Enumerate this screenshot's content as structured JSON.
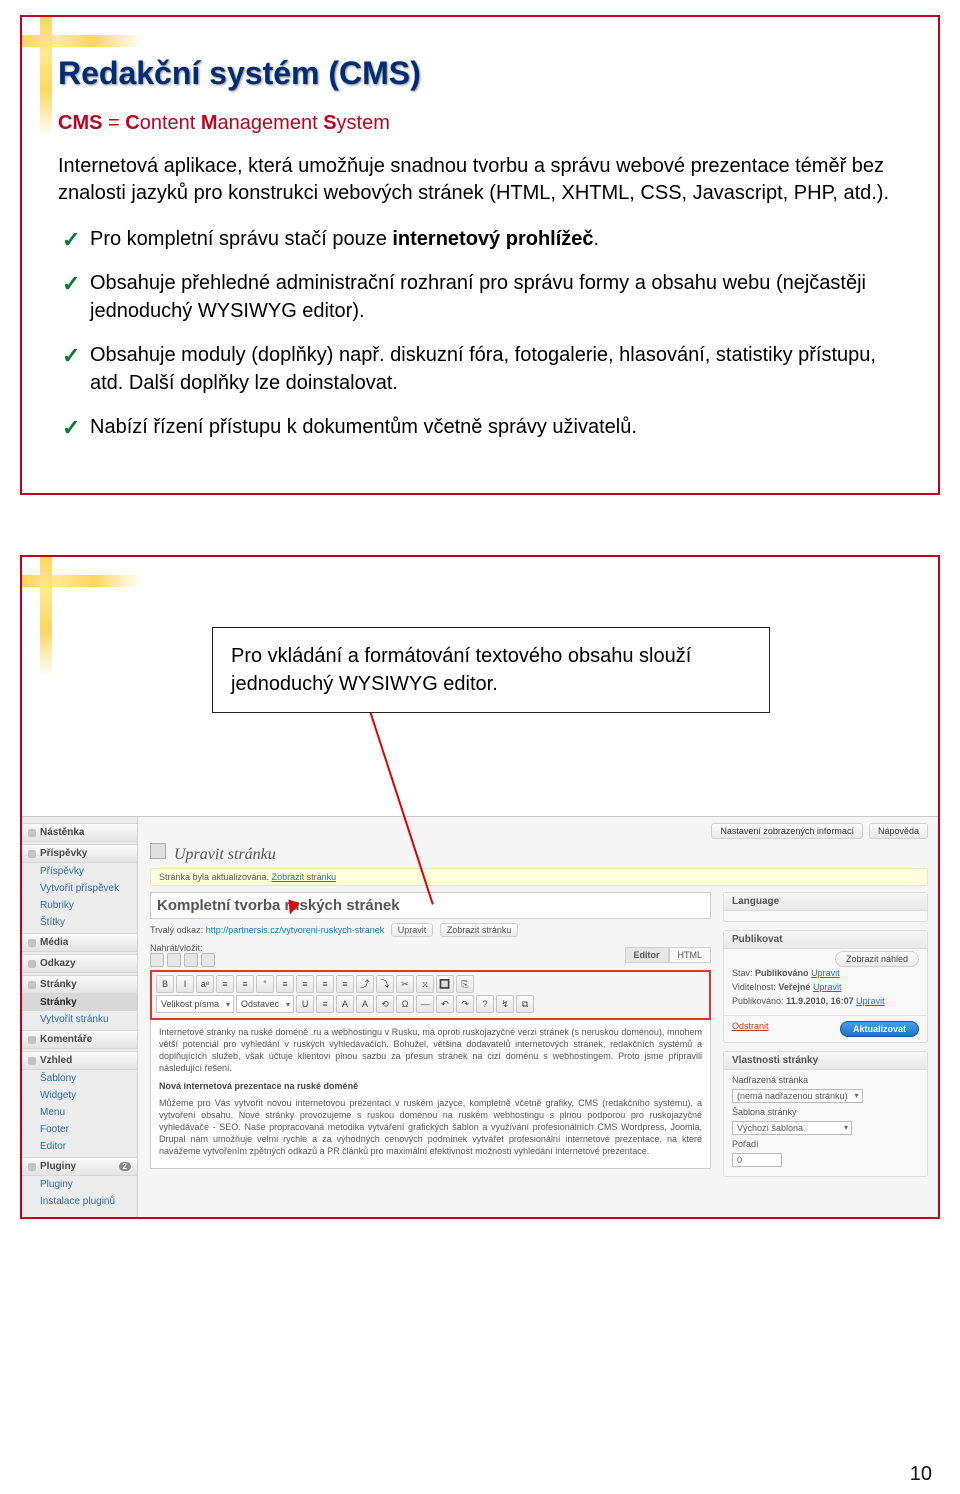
{
  "pageNumber": "10",
  "slide1": {
    "title": "Redakční systém (CMS)",
    "cms_prefix": "CMS",
    "cms_eq": " = ",
    "cms_c": "C",
    "cms_c_rest": "ontent ",
    "cms_m": "M",
    "cms_m_rest": "anagement ",
    "cms_s": "S",
    "cms_s_rest": "ystem",
    "intro": "Internetová aplikace, která umožňuje snadnou tvorbu a správu webové prezentace téměř bez znalosti jazyků pro konstrukci webových stránek (HTML, XHTML, CSS, Javascript, PHP, atd.).",
    "b1_a": "Pro kompletní správu stačí pouze ",
    "b1_b": "internetový prohlížeč",
    "b1_c": ".",
    "b2": "Obsahuje přehledné administrační rozhraní pro správu formy a obsahu webu (nejčastěji jednoduchý WYSIWYG editor).",
    "b3": "Obsahuje moduly (doplňky) např. diskuzní fóra, fotogalerie, hlasování, statistiky přístupu, atd. Další doplňky lze doinstalovat.",
    "b4": "Nabízí řízení přístupu k dokumentům včetně správy uživatelů."
  },
  "slide2": {
    "callout": "Pro vkládání a formátování textového obsahu slouží jednoduchý WYSIWYG editor.",
    "sidebar": {
      "nastenka": "Nástěnka",
      "prispevky_h": "Příspěvky",
      "prispevky": "Příspěvky",
      "vytvorit_pr": "Vytvořit příspěvek",
      "rubriky": "Rubriky",
      "stitky": "Štítky",
      "media_h": "Média",
      "odkazy_h": "Odkazy",
      "stranky_h": "Stránky",
      "stranky": "Stránky",
      "vytvorit_st": "Vytvořit stránku",
      "koment_h": "Komentáře",
      "vzhled_h": "Vzhled",
      "sablony": "Šablony",
      "widgety": "Widgety",
      "menu": "Menu",
      "footer": "Footer",
      "editor": "Editor",
      "pluginy_h": "Pluginy",
      "pluginy_badge": "2",
      "pluginy": "Pluginy",
      "instalace": "Instalace pluginů"
    },
    "topbar": {
      "chip1": "Nastavení zobrazených informací",
      "chip2": "Nápověda"
    },
    "header": {
      "title": "Upravit stránku",
      "notice_a": "Stránka byla aktualizována. ",
      "notice_link": "Zobrazit stránku"
    },
    "titleInput": "Kompletní tvorba ruských stránek",
    "permalink": {
      "label": "Trvalý odkaz:",
      "value": "http://partnersis.cz/vytvoreni-ruskych-stranek",
      "edit": "Upravit",
      "view": "Zobrazit stránku"
    },
    "insert": {
      "label": "Nahrát/vložit:",
      "tab_editor": "Editor",
      "tab_html": "HTML"
    },
    "toolbar": {
      "row1": [
        "B",
        "I",
        "aᵉ",
        "≡",
        "≡",
        "“",
        "≡",
        "≡",
        "≡",
        "≡",
        "⤴",
        "⤵",
        "✂",
        "𝚡",
        "🔲",
        "⎘"
      ],
      "font_label": "Velikost písma",
      "para_label": "Odstavec",
      "row2": [
        "U",
        "≡",
        "A",
        "A",
        "⟲",
        "Ω",
        "—",
        "↶",
        "↷",
        "?",
        "↯",
        "⧉"
      ]
    },
    "editorBody": {
      "p1": "Internetové stránky na ruské doméně .ru a webhostingu v Rusku, má oproti ruskojazyčné verzi stránek (s neruskou doménou), mnohem větší potenciál pro vyhledání v ruských vyhledávačích. Bohužel, většina dodavatelů internetových stránek, redakčních systémů a doplňujících služeb, však účtuje klientovi plnou sazbu za přesun stránek na cizí doménu s webhostingem. Proto jsme připravili následující řešení.",
      "h": "Nová internetová prezentace na ruské doméně",
      "p2": "Můžeme pro Vás vytvořit novou internetovou prezentaci v ruském jazyce, kompletně včetně grafiky, CMS (redakčního systému), a vytvoření obsahu. Nové stránky provozujeme s ruskou doménou na ruském webhostingu s plnou podporou pro ruskojazyčné vyhledávače - SEO. Naše propracovaná metodika vytváření grafických šablon a využívání profesionálních CMS Wordpress, Joomla, Drupal nám umožňuje velmi rychle a za výhodných cenových podmínek vytvářet profesionální internetové prezentace, na které navážeme vytvořením zpětných odkazů a PR článků pro maximální efektivnost možností vyhledání internetové prezentace."
    },
    "panels": {
      "lang_h": "Language",
      "pub_h": "Publikovat",
      "pub_preview": "Zobrazit náhled",
      "pub_state_l": "Stav:",
      "pub_state_v": "Publikováno",
      "pub_edit": "Upravit",
      "pub_vis_l": "Viditelnost:",
      "pub_vis_v": "Veřejné",
      "pub_date_l": "Publikováno:",
      "pub_date_v": "11.9.2010, 16:07",
      "delete": "Odstranit",
      "update": "Aktualizovat",
      "attr_h": "Vlastnosti stránky",
      "attr_parent_l": "Nadřazená stránka",
      "attr_parent_v": "(nemá nadřazenou stránku)",
      "attr_tpl_l": "Šablona stránky",
      "attr_tpl_v": "Výchozí šablona",
      "attr_order_l": "Pořadí",
      "attr_order_v": "0"
    }
  }
}
